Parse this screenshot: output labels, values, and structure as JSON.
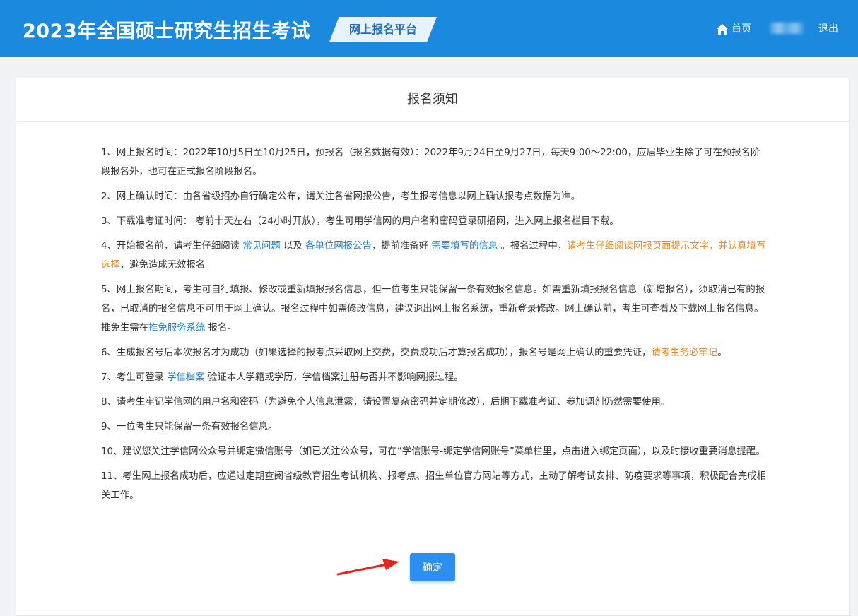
{
  "header": {
    "title": "2023年全国硕士研究生招生考试",
    "platform_badge": "网上报名平台",
    "nav": {
      "home": "首页",
      "logout": "退出"
    }
  },
  "notice": {
    "title": "报名须知",
    "items": [
      {
        "text": "1、网上报名时间：2022年10月5日至10月25日，预报名（报名数据有效）：2022年9月24日至9月27日，每天9:00～22:00，应届毕业生除了可在预报名阶段报名外，也可在正式报名阶段报名。"
      },
      {
        "text": "2、网上确认时间：由各省级招办自行确定公布，请关注各省网报公告，考生报考信息以网上确认报考点数据为准。"
      },
      {
        "text": "3、下载准考证时间： 考前十天左右（24小时开放），考生可用学信网的用户名和密码登录研招网，进入网上报名栏目下载。"
      },
      {
        "p1": "4、开始报名前，请考生仔细阅读 ",
        "link1": "常见问题",
        "p2": " 以及 ",
        "link2": "各单位网报公告",
        "p3": "，提前准备好 ",
        "link3": "需要填写的信息",
        "p4": " 。报名过程中，",
        "warn": "请考生仔细阅读网报页面提示文字，并认真填写选择",
        "p5": "，避免造成无效报名。"
      },
      {
        "p1": "5、网上报名期间，考生可自行填报、修改或重新填报报名信息，但一位考生只能保留一条有效报名信息。如需重新填报报名信息（新增报名），须取消已有的报名，已取消的报名信息不可用于网上确认。报名过程中如需修改信息，建议退出网上报名系统，重新登录修改。网上确认前，考生可查看及下载网上报名信息。推免生需在",
        "link1": "推免服务系统",
        "p2": " 报名。"
      },
      {
        "p1": "6、生成报名号后本次报名才为成功（如果选择的报考点采取网上交费，交费成功后才算报名成功），报名号是网上确认的重要凭证，",
        "warn": "请考生务必牢记",
        "p2": "。"
      },
      {
        "p1": "7、考生可登录 ",
        "link1": "学信档案",
        "p2": " 验证本人学籍或学历，学信档案注册与否并不影响网报过程。"
      },
      {
        "text": "8、请考生牢记学信网的用户名和密码（为避免个人信息泄露，请设置复杂密码并定期修改），后期下载准考证、参加调剂仍然需要使用。"
      },
      {
        "text": "9、一位考生只能保留一条有效报名信息。"
      },
      {
        "text": "10、建议您关注学信网公众号并绑定微信账号（如已关注公众号，可在“学信账号-绑定学信网账号”菜单栏里，点击进入绑定页面），以及时接收重要消息提醒。"
      },
      {
        "text": "11、考生网上报名成功后，应通过定期查阅省级教育招生考试机构、报考点、招生单位官方网站等方式，主动了解考试安排、防疫要求等事项，积极配合完成相关工作。"
      }
    ],
    "confirm_label": "确定"
  },
  "icons": {
    "home": "home-icon",
    "annotation": "red-arrow-icon"
  },
  "colors": {
    "header_bg": "#1b89dd",
    "link": "#1a7fd0",
    "warning": "#f08a1d",
    "button": "#2a8ff0"
  }
}
